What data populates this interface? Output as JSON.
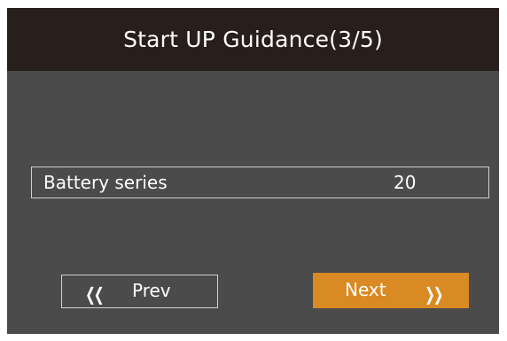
{
  "header": {
    "title": "Start UP Guidance(3/5)"
  },
  "field": {
    "label": "Battery series",
    "value": "20"
  },
  "buttons": {
    "prev": {
      "label": "Prev",
      "icon": "double-chevron-left-icon"
    },
    "next": {
      "label": "Next",
      "icon": "double-chevron-right-icon"
    }
  },
  "colors": {
    "panel": "#4a4b4a",
    "header": "#281e1c",
    "accent": "#d98a22",
    "text": "#ffffff"
  }
}
